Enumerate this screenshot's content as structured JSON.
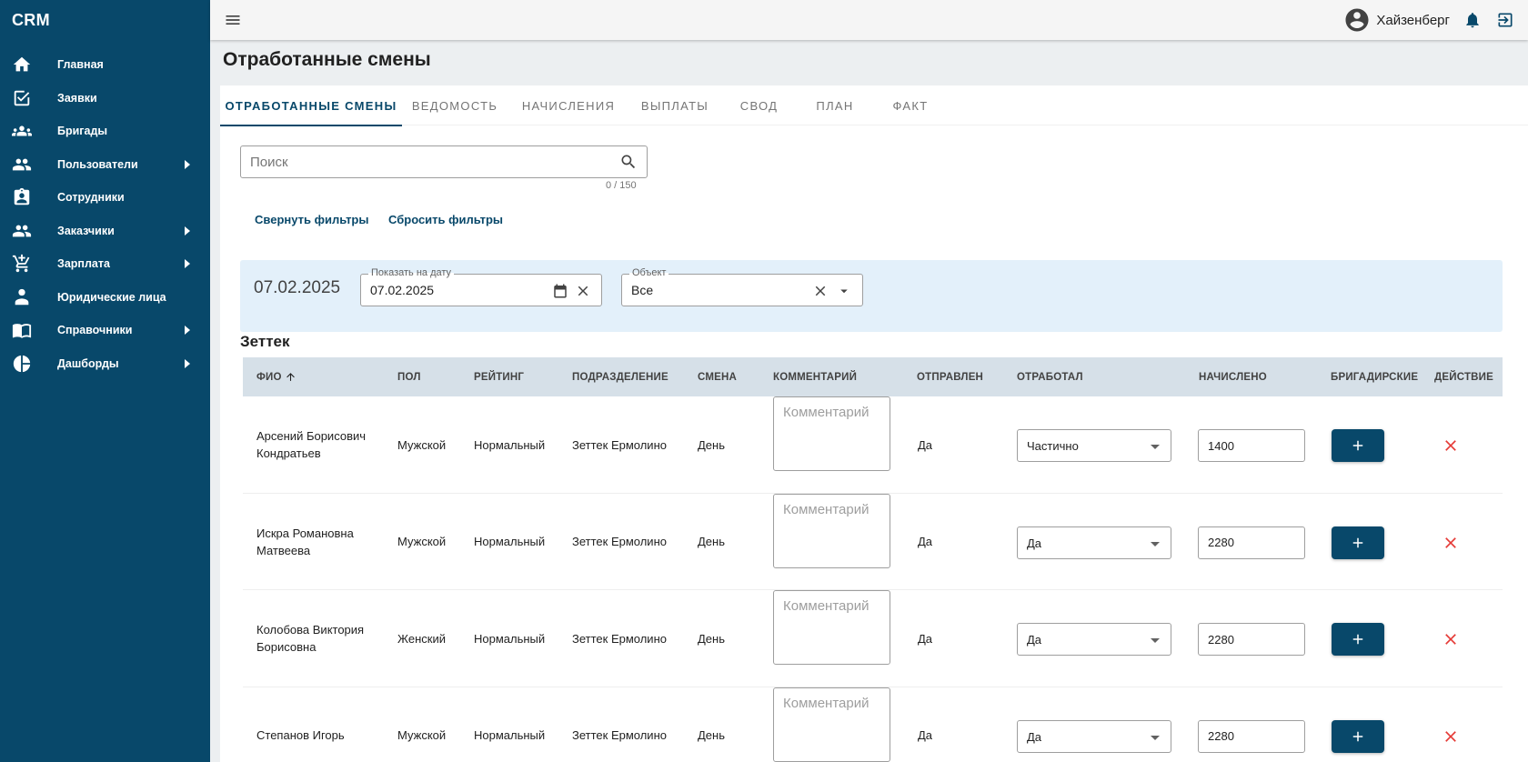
{
  "app": {
    "brand": "CRM"
  },
  "sidebar": {
    "items": [
      {
        "label": "Главная",
        "icon": "home-icon",
        "submenu": false
      },
      {
        "label": "Заявки",
        "icon": "checkbox-icon",
        "submenu": false
      },
      {
        "label": "Бригады",
        "icon": "group-icon",
        "submenu": false
      },
      {
        "label": "Пользователи",
        "icon": "people-icon",
        "submenu": true
      },
      {
        "label": "Сотрудники",
        "icon": "badge-icon",
        "submenu": false
      },
      {
        "label": "Заказчики",
        "icon": "people-icon",
        "submenu": true
      },
      {
        "label": "Зарплата",
        "icon": "cart-icon",
        "submenu": true
      },
      {
        "label": "Юридические лица",
        "icon": "person-tie-icon",
        "submenu": false
      },
      {
        "label": "Справочники",
        "icon": "book-icon",
        "submenu": true
      },
      {
        "label": "Дашборды",
        "icon": "pie-chart-icon",
        "submenu": true
      }
    ]
  },
  "topbar": {
    "username": "Хайзенберг"
  },
  "page": {
    "title": "Отработанные смены"
  },
  "tabs": [
    {
      "label": "ОТРАБОТАННЫЕ СМЕНЫ",
      "active": true
    },
    {
      "label": "ВЕДОМОСТЬ",
      "active": false
    },
    {
      "label": "НАЧИСЛЕНИЯ",
      "active": false
    },
    {
      "label": "ВЫПЛАТЫ",
      "active": false
    },
    {
      "label": "СВОД",
      "active": false
    },
    {
      "label": "ПЛАН",
      "active": false
    },
    {
      "label": "ФАКТ",
      "active": false
    }
  ],
  "search": {
    "placeholder": "Поиск",
    "value": "",
    "counter": "0 / 150"
  },
  "filters": {
    "collapse_label": "Свернуть фильтры",
    "reset_label": "Сбросить фильтры",
    "current_date": "07.02.2025",
    "date_field": {
      "label": "Показать на дату",
      "value": "07.02.2025"
    },
    "object_field": {
      "label": "Объект",
      "value": "Все"
    }
  },
  "group": {
    "title": "Зеттек"
  },
  "table": {
    "columns": [
      "ФИО",
      "ПОЛ",
      "РЕЙТИНГ",
      "ПОДРАЗДЕЛЕНИЕ",
      "СМЕНА",
      "КОММЕНТАРИЙ",
      "ОТПРАВЛЕН",
      "ОТРАБОТАЛ",
      "НАЧИСЛЕНО",
      "БРИГАДИРСКИЕ",
      "ДЕЙСТВИЕ"
    ],
    "comment_placeholder": "Комментарий",
    "rows": [
      {
        "name": "Арсений Борисович Кондратьев",
        "gender": "Мужской",
        "rating": "Нормальный",
        "division": "Зеттек Ермолино",
        "shift": "День",
        "comment": "",
        "sent": "Да",
        "worked": "Частично",
        "amount": "1400"
      },
      {
        "name": "Искра Романовна Матвеева",
        "gender": "Мужской",
        "rating": "Нормальный",
        "division": "Зеттек Ермолино",
        "shift": "День",
        "comment": "",
        "sent": "Да",
        "worked": "Да",
        "amount": "2280"
      },
      {
        "name": "Колобова Виктория Борисовна",
        "gender": "Женский",
        "rating": "Нормальный",
        "division": "Зеттек Ермолино",
        "shift": "День",
        "comment": "",
        "sent": "Да",
        "worked": "Да",
        "amount": "2280"
      },
      {
        "name": "Степанов Игорь",
        "gender": "Мужской",
        "rating": "Нормальный",
        "division": "Зеттек Ермолино",
        "shift": "День",
        "comment": "",
        "sent": "Да",
        "worked": "Да",
        "amount": "2280"
      }
    ]
  },
  "colors": {
    "primary": "#08486a",
    "header_bg": "#d6e0e8",
    "filter_bg": "#e3f0fa",
    "delete": "#e53935"
  }
}
